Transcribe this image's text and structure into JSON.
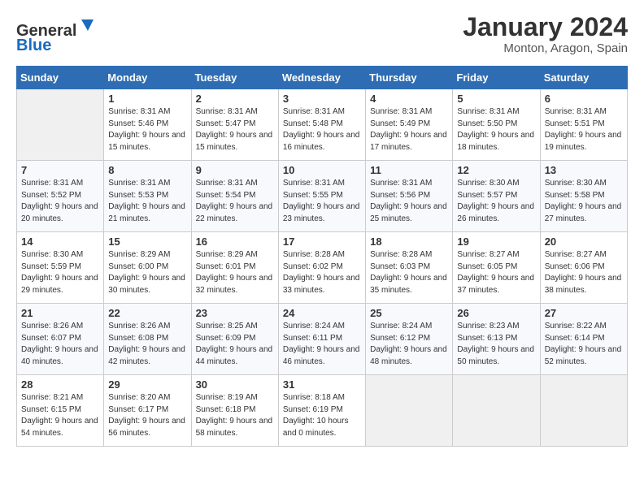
{
  "header": {
    "logo_general": "General",
    "logo_blue": "Blue",
    "title": "January 2024",
    "subtitle": "Monton, Aragon, Spain"
  },
  "weekdays": [
    "Sunday",
    "Monday",
    "Tuesday",
    "Wednesday",
    "Thursday",
    "Friday",
    "Saturday"
  ],
  "weeks": [
    [
      {
        "day": "",
        "empty": true
      },
      {
        "day": "1",
        "sunrise": "Sunrise: 8:31 AM",
        "sunset": "Sunset: 5:46 PM",
        "daylight": "Daylight: 9 hours and 15 minutes."
      },
      {
        "day": "2",
        "sunrise": "Sunrise: 8:31 AM",
        "sunset": "Sunset: 5:47 PM",
        "daylight": "Daylight: 9 hours and 15 minutes."
      },
      {
        "day": "3",
        "sunrise": "Sunrise: 8:31 AM",
        "sunset": "Sunset: 5:48 PM",
        "daylight": "Daylight: 9 hours and 16 minutes."
      },
      {
        "day": "4",
        "sunrise": "Sunrise: 8:31 AM",
        "sunset": "Sunset: 5:49 PM",
        "daylight": "Daylight: 9 hours and 17 minutes."
      },
      {
        "day": "5",
        "sunrise": "Sunrise: 8:31 AM",
        "sunset": "Sunset: 5:50 PM",
        "daylight": "Daylight: 9 hours and 18 minutes."
      },
      {
        "day": "6",
        "sunrise": "Sunrise: 8:31 AM",
        "sunset": "Sunset: 5:51 PM",
        "daylight": "Daylight: 9 hours and 19 minutes."
      }
    ],
    [
      {
        "day": "7",
        "sunrise": "Sunrise: 8:31 AM",
        "sunset": "Sunset: 5:52 PM",
        "daylight": "Daylight: 9 hours and 20 minutes."
      },
      {
        "day": "8",
        "sunrise": "Sunrise: 8:31 AM",
        "sunset": "Sunset: 5:53 PM",
        "daylight": "Daylight: 9 hours and 21 minutes."
      },
      {
        "day": "9",
        "sunrise": "Sunrise: 8:31 AM",
        "sunset": "Sunset: 5:54 PM",
        "daylight": "Daylight: 9 hours and 22 minutes."
      },
      {
        "day": "10",
        "sunrise": "Sunrise: 8:31 AM",
        "sunset": "Sunset: 5:55 PM",
        "daylight": "Daylight: 9 hours and 23 minutes."
      },
      {
        "day": "11",
        "sunrise": "Sunrise: 8:31 AM",
        "sunset": "Sunset: 5:56 PM",
        "daylight": "Daylight: 9 hours and 25 minutes."
      },
      {
        "day": "12",
        "sunrise": "Sunrise: 8:30 AM",
        "sunset": "Sunset: 5:57 PM",
        "daylight": "Daylight: 9 hours and 26 minutes."
      },
      {
        "day": "13",
        "sunrise": "Sunrise: 8:30 AM",
        "sunset": "Sunset: 5:58 PM",
        "daylight": "Daylight: 9 hours and 27 minutes."
      }
    ],
    [
      {
        "day": "14",
        "sunrise": "Sunrise: 8:30 AM",
        "sunset": "Sunset: 5:59 PM",
        "daylight": "Daylight: 9 hours and 29 minutes."
      },
      {
        "day": "15",
        "sunrise": "Sunrise: 8:29 AM",
        "sunset": "Sunset: 6:00 PM",
        "daylight": "Daylight: 9 hours and 30 minutes."
      },
      {
        "day": "16",
        "sunrise": "Sunrise: 8:29 AM",
        "sunset": "Sunset: 6:01 PM",
        "daylight": "Daylight: 9 hours and 32 minutes."
      },
      {
        "day": "17",
        "sunrise": "Sunrise: 8:28 AM",
        "sunset": "Sunset: 6:02 PM",
        "daylight": "Daylight: 9 hours and 33 minutes."
      },
      {
        "day": "18",
        "sunrise": "Sunrise: 8:28 AM",
        "sunset": "Sunset: 6:03 PM",
        "daylight": "Daylight: 9 hours and 35 minutes."
      },
      {
        "day": "19",
        "sunrise": "Sunrise: 8:27 AM",
        "sunset": "Sunset: 6:05 PM",
        "daylight": "Daylight: 9 hours and 37 minutes."
      },
      {
        "day": "20",
        "sunrise": "Sunrise: 8:27 AM",
        "sunset": "Sunset: 6:06 PM",
        "daylight": "Daylight: 9 hours and 38 minutes."
      }
    ],
    [
      {
        "day": "21",
        "sunrise": "Sunrise: 8:26 AM",
        "sunset": "Sunset: 6:07 PM",
        "daylight": "Daylight: 9 hours and 40 minutes."
      },
      {
        "day": "22",
        "sunrise": "Sunrise: 8:26 AM",
        "sunset": "Sunset: 6:08 PM",
        "daylight": "Daylight: 9 hours and 42 minutes."
      },
      {
        "day": "23",
        "sunrise": "Sunrise: 8:25 AM",
        "sunset": "Sunset: 6:09 PM",
        "daylight": "Daylight: 9 hours and 44 minutes."
      },
      {
        "day": "24",
        "sunrise": "Sunrise: 8:24 AM",
        "sunset": "Sunset: 6:11 PM",
        "daylight": "Daylight: 9 hours and 46 minutes."
      },
      {
        "day": "25",
        "sunrise": "Sunrise: 8:24 AM",
        "sunset": "Sunset: 6:12 PM",
        "daylight": "Daylight: 9 hours and 48 minutes."
      },
      {
        "day": "26",
        "sunrise": "Sunrise: 8:23 AM",
        "sunset": "Sunset: 6:13 PM",
        "daylight": "Daylight: 9 hours and 50 minutes."
      },
      {
        "day": "27",
        "sunrise": "Sunrise: 8:22 AM",
        "sunset": "Sunset: 6:14 PM",
        "daylight": "Daylight: 9 hours and 52 minutes."
      }
    ],
    [
      {
        "day": "28",
        "sunrise": "Sunrise: 8:21 AM",
        "sunset": "Sunset: 6:15 PM",
        "daylight": "Daylight: 9 hours and 54 minutes."
      },
      {
        "day": "29",
        "sunrise": "Sunrise: 8:20 AM",
        "sunset": "Sunset: 6:17 PM",
        "daylight": "Daylight: 9 hours and 56 minutes."
      },
      {
        "day": "30",
        "sunrise": "Sunrise: 8:19 AM",
        "sunset": "Sunset: 6:18 PM",
        "daylight": "Daylight: 9 hours and 58 minutes."
      },
      {
        "day": "31",
        "sunrise": "Sunrise: 8:18 AM",
        "sunset": "Sunset: 6:19 PM",
        "daylight": "Daylight: 10 hours and 0 minutes."
      },
      {
        "day": "",
        "empty": true
      },
      {
        "day": "",
        "empty": true
      },
      {
        "day": "",
        "empty": true
      }
    ]
  ]
}
